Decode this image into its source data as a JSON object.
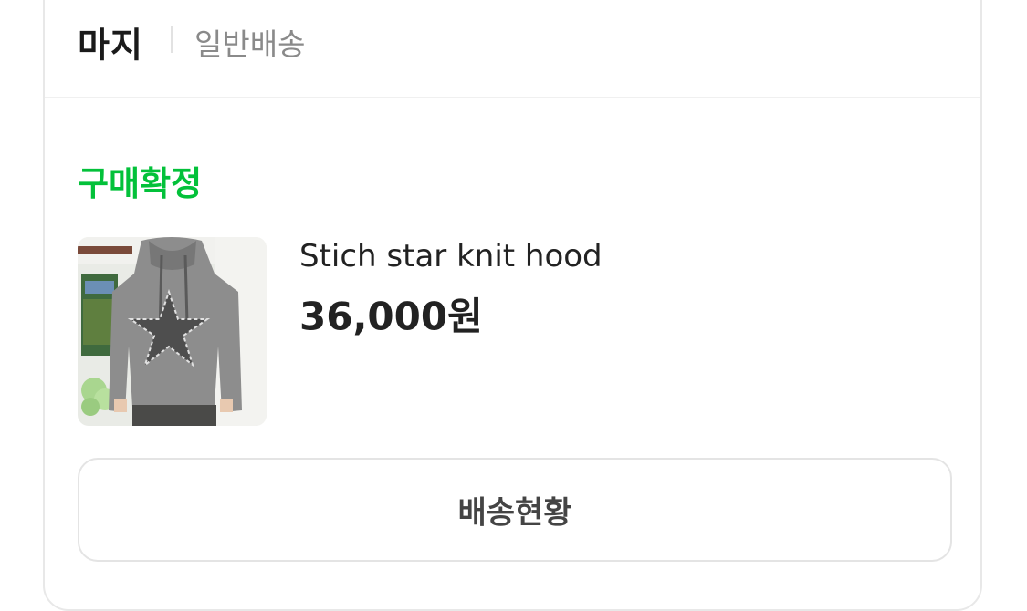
{
  "header": {
    "store_name": "마지",
    "shipping_type": "일반배송"
  },
  "order": {
    "status": "구매확정",
    "status_color": "#03c13a"
  },
  "product": {
    "name": "Stich star knit hood",
    "price": "36,000원",
    "image_icon": "hoodie-photo"
  },
  "actions": {
    "track_label": "배송현황"
  }
}
